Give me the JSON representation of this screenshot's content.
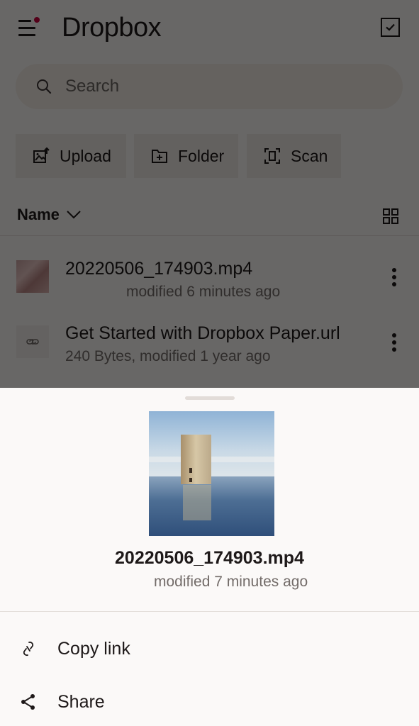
{
  "header": {
    "title": "Dropbox",
    "menu_icon": "hamburger-menu-icon",
    "notification_dot_color": "#c8003c",
    "select_icon": "checkbox-select-icon"
  },
  "search": {
    "placeholder": "Search",
    "value": "",
    "icon": "search-icon"
  },
  "actions": [
    {
      "label": "Upload",
      "icon": "upload-photo-icon"
    },
    {
      "label": "Folder",
      "icon": "new-folder-icon"
    },
    {
      "label": "Scan",
      "icon": "scan-icon"
    }
  ],
  "sort": {
    "label": "Name",
    "icon": "chevron-down-icon",
    "view_toggle_icon": "grid-view-icon"
  },
  "files": [
    {
      "name": "20220506_174903.mp4",
      "meta": "modified 6 minutes ago",
      "icon": "video-thumbnail"
    },
    {
      "name": "Get Started with Dropbox Paper.url",
      "meta": "240 Bytes, modified 1 year ago",
      "icon": "link-file-icon"
    }
  ],
  "sheet": {
    "file_name": "20220506_174903.mp4",
    "file_meta": "modified 7 minutes ago",
    "preview": "tower-in-water-photo",
    "items": [
      {
        "label": "Copy link",
        "icon": "link-icon"
      },
      {
        "label": "Share",
        "icon": "share-icon"
      }
    ]
  },
  "colors": {
    "background": "#f7f5f2",
    "text": "#1e1919",
    "muted_text": "#736c69",
    "button_bg": "#ece7e3",
    "search_bg": "#f0e9e3",
    "sheet_bg": "#fbf9f8"
  }
}
